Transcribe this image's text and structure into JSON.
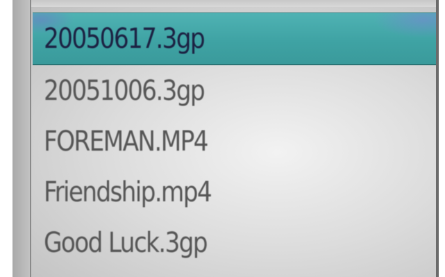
{
  "file_list": {
    "items": [
      {
        "name": "20050617.3gp",
        "selected": true
      },
      {
        "name": "20051006.3gp",
        "selected": false
      },
      {
        "name": "FOREMAN.MP4",
        "selected": false
      },
      {
        "name": "Friendship.mp4",
        "selected": false
      },
      {
        "name": "Good Luck.3gp",
        "selected": false
      }
    ]
  },
  "colors": {
    "selection": "#41a5a6",
    "text": "#555555",
    "selected_text": "#1c2142",
    "background": "#dcdcdc"
  }
}
